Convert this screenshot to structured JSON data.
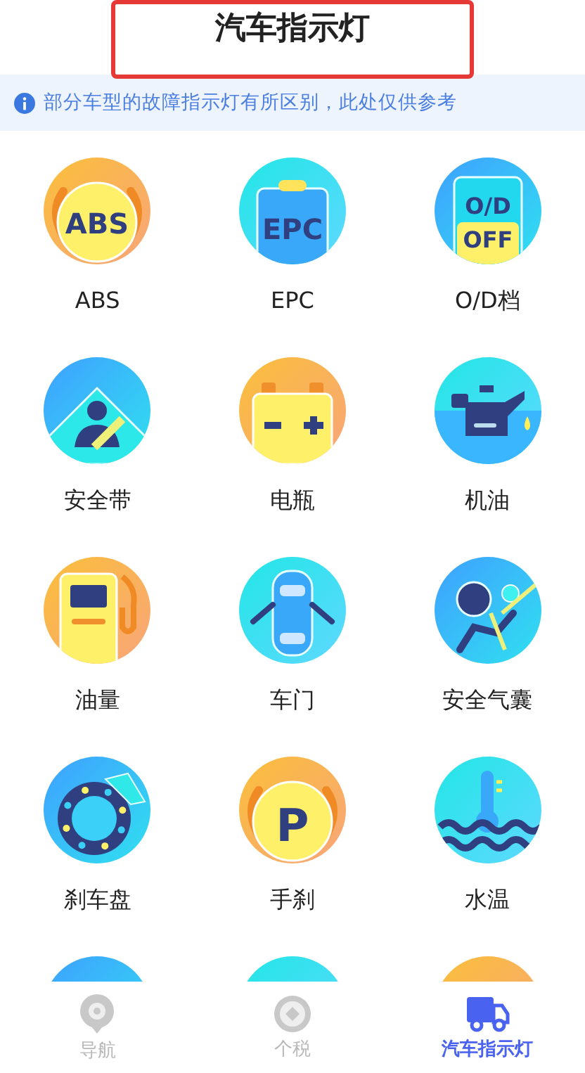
{
  "header": {
    "title": "汽车指示灯"
  },
  "notice": {
    "text": "部分车型的故障指示灯有所区别，此处仅供参考"
  },
  "lights": [
    {
      "kind": "abs",
      "label": "ABS",
      "icon_text": [
        "ABS"
      ]
    },
    {
      "kind": "epc",
      "label": "EPC",
      "icon_text": [
        "EPC"
      ]
    },
    {
      "kind": "od",
      "label": "O/D档",
      "icon_text": [
        "O/D",
        "OFF"
      ]
    },
    {
      "kind": "seatbelt",
      "label": "安全带"
    },
    {
      "kind": "battery",
      "label": "电瓶"
    },
    {
      "kind": "oil",
      "label": "机油"
    },
    {
      "kind": "fuel",
      "label": "油量"
    },
    {
      "kind": "door",
      "label": "车门"
    },
    {
      "kind": "airbag",
      "label": "安全气囊"
    },
    {
      "kind": "brake",
      "label": "刹车盘"
    },
    {
      "kind": "parking",
      "label": "手刹",
      "icon_text": [
        "P"
      ]
    },
    {
      "kind": "water",
      "label": "水温"
    },
    {
      "kind": "partial_blue"
    },
    {
      "kind": "partial_cyan"
    },
    {
      "kind": "partial_orange"
    }
  ],
  "tabs": [
    {
      "kind": "nav",
      "label": "导航",
      "selected": false
    },
    {
      "kind": "tax",
      "label": "个税",
      "selected": false
    },
    {
      "kind": "truck",
      "label": "汽车指示灯",
      "selected": true
    }
  ]
}
